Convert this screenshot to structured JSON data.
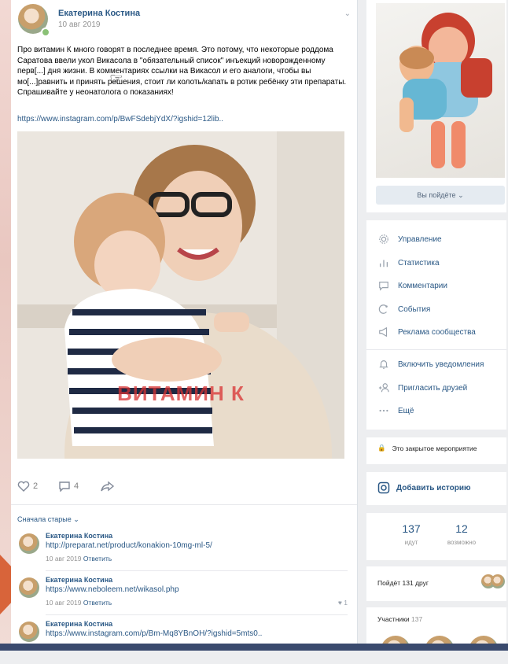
{
  "post": {
    "author": "Екатерина Костина",
    "date": "10 авг 2019",
    "text": "Про витамин К много говорят в последнее время. Это потому, что некоторые роддома Саратова ввели укол Викасола в \"обязательный список\" инъекций новорожденному перв[...] дня жизни. В комментариях ссылки на Викасол и его аналоги, чтобы вы мо[...]равнить и принять решения, стоит ли колоть/капать в ротик ребёнку эти препараты. Спрашивайте у неонатолога о показаниях!",
    "link": "https://www.instagram.com/p/BwFSdebjYdX/?igshid=12lib..",
    "image_caption": "ВИТАМИН К",
    "likes": "2",
    "comments": "4"
  },
  "comments_sort": "Сначала старые",
  "comments": [
    {
      "author": "Екатерина Костина",
      "link": "http://preparat.net/product/konakion-10mg-ml-5/",
      "date": "10 авг 2019",
      "reply": "Ответить",
      "likes": ""
    },
    {
      "author": "Екатерина Костина",
      "link": "https://www.neboleem.net/wikasol.php",
      "date": "10 авг 2019",
      "reply": "Ответить",
      "likes": "1"
    },
    {
      "author": "Екатерина Костина",
      "link": "https://www.instagram.com/p/Bm-Mq8YBnOH/?igshid=5mts0..",
      "date": "",
      "reply": "",
      "likes": ""
    }
  ],
  "event": {
    "go_button": "Вы пойдёте",
    "menu": [
      {
        "label": "Управление",
        "icon": "gear-icon"
      },
      {
        "label": "Статистика",
        "icon": "stats-icon"
      },
      {
        "label": "Комментарии",
        "icon": "comment-icon"
      },
      {
        "label": "События",
        "icon": "events-icon"
      },
      {
        "label": "Реклама сообщества",
        "icon": "megaphone-icon"
      }
    ],
    "menu2": [
      {
        "label": "Включить уведомления",
        "icon": "bell-icon"
      },
      {
        "label": "Пригласить друзей",
        "icon": "invite-icon"
      },
      {
        "label": "Ещё",
        "icon": "more-icon"
      }
    ],
    "private_label": "Это закрытое мероприятие",
    "story_label": "Добавить историю",
    "stats": [
      {
        "num": "137",
        "label": "идут"
      },
      {
        "num": "12",
        "label": "возможно"
      }
    ],
    "friends_going": "Пойдёт 131 друг",
    "members_label": "Участники",
    "members_count": "137"
  },
  "colors": {
    "link": "#2a5885",
    "background": "#edeef0",
    "accent_orange": "#d8643a"
  }
}
